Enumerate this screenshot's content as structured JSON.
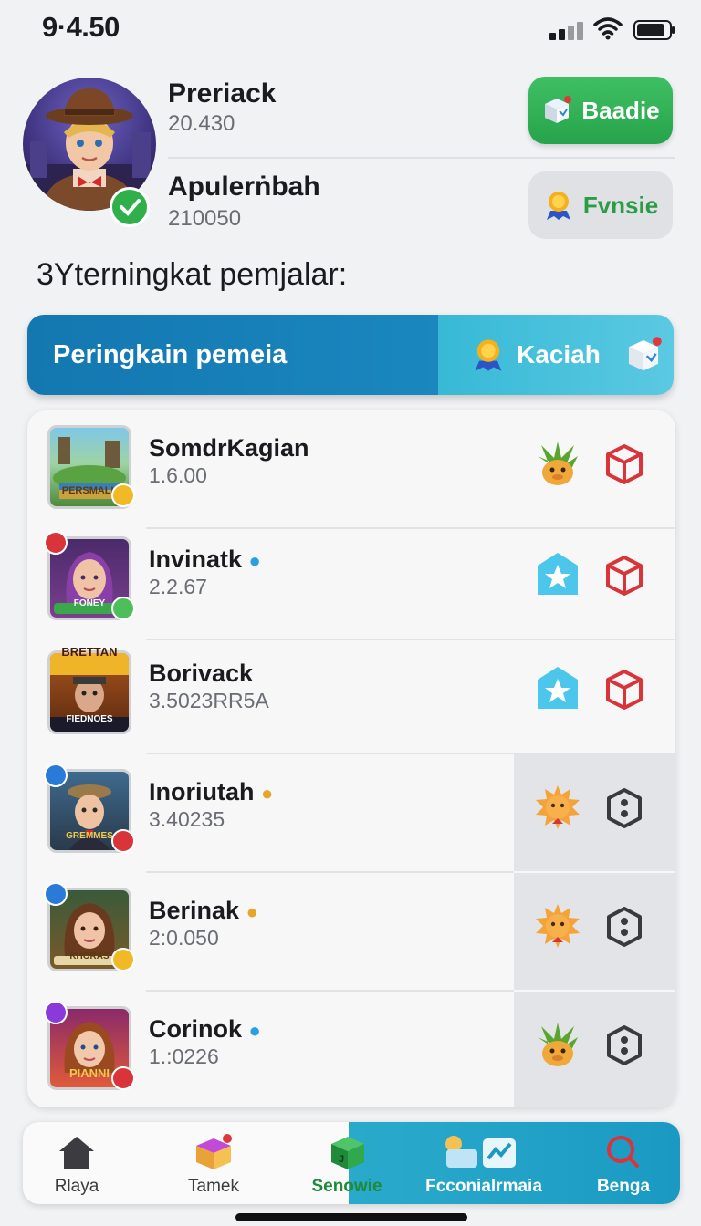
{
  "status_bar": {
    "time": "9·4.50"
  },
  "header": {
    "player1": {
      "name": "Preriack",
      "score": "20.430"
    },
    "player2": {
      "name": "Apulerṅbah",
      "score": "210050"
    },
    "button_primary": "Baadie",
    "button_secondary": "Fvnsie"
  },
  "section_title": "3Yterningkat pemjalar:",
  "banner": {
    "left_label": "Peringkain pemeia",
    "right_label": "Kaciah"
  },
  "list": [
    {
      "name": "SomdrKagian",
      "score": "1.6.00",
      "thumb_text": "PERSMALL"
    },
    {
      "name": "Invinatk",
      "score": "2.2.67",
      "thumb_text": "FONEY"
    },
    {
      "name": "Borivack",
      "score": "3.5023RR5A",
      "thumb_text": "FIEDNOES",
      "thumb_top": "BRETTAN"
    },
    {
      "name": "Inoriutah",
      "score": "3.40235",
      "thumb_text": "GREMMES"
    },
    {
      "name": "Berinak",
      "score": "2:0.050",
      "thumb_text": "KHORAS"
    },
    {
      "name": "Corinok",
      "score": "1.:0226",
      "thumb_text": "PIANNI"
    }
  ],
  "bottom_nav": [
    {
      "label": "Rlaya"
    },
    {
      "label": "Tamek"
    },
    {
      "label": "Senowie"
    },
    {
      "label": "Fcconialrmaia"
    },
    {
      "label": "Benga"
    }
  ],
  "colors": {
    "accent_green": "#2fb04a",
    "banner_blue": "#1477b0",
    "banner_teal": "#37b9d6",
    "nav_teal": "#1a9ac3",
    "red_cube": "#d8343a"
  }
}
